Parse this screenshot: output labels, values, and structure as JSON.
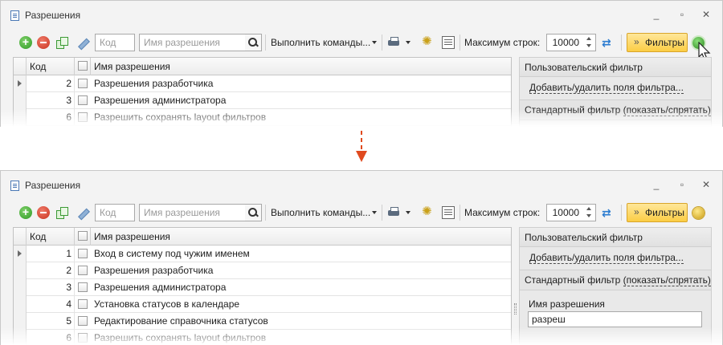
{
  "window": {
    "title": "Разрешения",
    "minimize_label": "_",
    "restore_label": "▫",
    "close_label": "✕"
  },
  "toolbar": {
    "code_placeholder": "Код",
    "name_placeholder": "Имя разрешения",
    "execute_label": "Выполнить команды...",
    "max_rows_label": "Максимум строк:",
    "max_rows_value": "10000",
    "filters_label": "Фильтры"
  },
  "grid": {
    "col_code": "Код",
    "col_name": "Имя разрешения"
  },
  "top_rows": [
    {
      "code": "2",
      "name": "Разрешения разработчика"
    },
    {
      "code": "3",
      "name": "Разрешения администратора"
    },
    {
      "code": "6",
      "name": "Разрешить сохранять layout фильтров"
    }
  ],
  "bottom_rows": [
    {
      "code": "1",
      "name": "Вход в систему под чужим именем"
    },
    {
      "code": "2",
      "name": "Разрешения разработчика"
    },
    {
      "code": "3",
      "name": "Разрешения администратора"
    },
    {
      "code": "4",
      "name": "Установка статусов в календаре"
    },
    {
      "code": "5",
      "name": "Редактирование справочника статусов"
    },
    {
      "code": "6",
      "name": "Разрешить сохранять layout фильтров"
    }
  ],
  "side_panel": {
    "user_filter": "Пользовательский фильтр",
    "add_remove_fields": "Добавить/удалить поля фильтра...",
    "standard_filter": "Стандартный фильтр",
    "show_hide": "(показать/спрятать)",
    "field_label": "Имя разрешения",
    "field_value": "разреш"
  },
  "colors": {
    "filter_button": "#fbcd44",
    "status_active": "#2c8a1f",
    "status_idle": "#c89a12",
    "arrow": "#e04a1f"
  }
}
